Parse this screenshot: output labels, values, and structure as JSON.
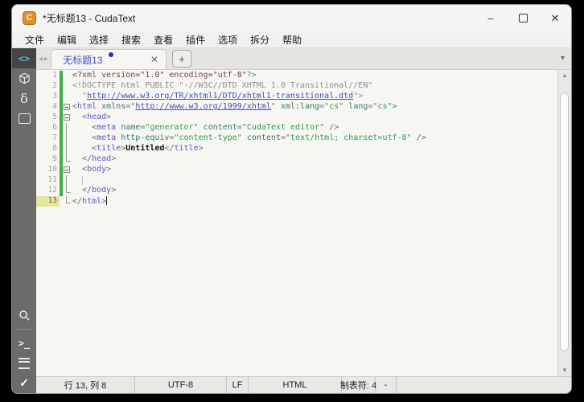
{
  "window": {
    "title": "*无标题13 - CudaText",
    "app_icon_letter": "C",
    "controls": {
      "minimize": "–",
      "close": "✕"
    }
  },
  "menu": {
    "items": [
      "文件",
      "编辑",
      "选择",
      "搜索",
      "查看",
      "插件",
      "选项",
      "拆分",
      "帮助"
    ]
  },
  "tabbar": {
    "nav_left": "◂",
    "nav_right": "▸",
    "tab_label": "无标题13",
    "tab_modified": true,
    "tab_close": "✕",
    "new_tab": "+",
    "chevron": "▾"
  },
  "sidebar": {
    "top_icons": [
      {
        "name": "code-tree-icon",
        "glyph": "code",
        "text": "<>",
        "active": true
      },
      {
        "name": "project-icon",
        "glyph": "cube",
        "text": ""
      },
      {
        "name": "snippets-icon",
        "glyph": "delta",
        "text": "δ"
      },
      {
        "name": "tabs-panel-icon",
        "glyph": "rect",
        "text": ""
      }
    ],
    "bottom_icons": [
      {
        "name": "search-icon",
        "glyph": "search",
        "text": ""
      },
      {
        "name": "divider",
        "glyph": "divider",
        "text": ""
      },
      {
        "name": "console-icon",
        "glyph": "console",
        "text": ">_"
      },
      {
        "name": "output-icon",
        "glyph": "menu",
        "text": ""
      },
      {
        "name": "validate-icon",
        "glyph": "check",
        "text": "✓"
      }
    ]
  },
  "scrollbar": {
    "up": "▲",
    "down": "▼"
  },
  "statusbar": {
    "cells": [
      "行 13, 列 8",
      "UTF-8",
      "LF",
      "HTML",
      "制表符: 4",
      "-"
    ]
  },
  "editor": {
    "lines": [
      {
        "num": 1,
        "fold": "none",
        "changed": true,
        "tokens": [
          {
            "c": "pi",
            "t": "<?xml version=\"1.0\" encoding=\"utf-8\""
          },
          {
            "c": "pig",
            "t": "?>"
          }
        ]
      },
      {
        "num": 2,
        "fold": "none",
        "changed": true,
        "tokens": [
          {
            "c": "cm",
            "t": "<!DOCTYPE html PUBLIC \"-//W3C//DTD XHTML 1.0 Transitional//EN\""
          }
        ]
      },
      {
        "num": 3,
        "fold": "none",
        "changed": true,
        "tokens": [
          {
            "c": "cm",
            "t": "  \""
          },
          {
            "c": "url",
            "t": "http://www.w3.org/TR/xhtml1/DTD/xhtml1-transitional.dtd"
          },
          {
            "c": "cm",
            "t": "\">"
          }
        ]
      },
      {
        "num": 4,
        "fold": "box",
        "changed": true,
        "tokens": [
          {
            "c": "br",
            "t": "<"
          },
          {
            "c": "tag",
            "t": "html"
          },
          {
            "c": "pl",
            "t": " "
          },
          {
            "c": "attr",
            "t": "xmlns"
          },
          {
            "c": "br",
            "t": "="
          },
          {
            "c": "str",
            "t": "\""
          },
          {
            "c": "url",
            "t": "http://www.w3.org/1999/xhtml"
          },
          {
            "c": "str",
            "t": "\""
          },
          {
            "c": "pl",
            "t": " "
          },
          {
            "c": "attr",
            "t": "xml:lang"
          },
          {
            "c": "br",
            "t": "="
          },
          {
            "c": "str",
            "t": "\"cs\""
          },
          {
            "c": "pl",
            "t": " "
          },
          {
            "c": "attr",
            "t": "lang"
          },
          {
            "c": "br",
            "t": "="
          },
          {
            "c": "str",
            "t": "\"cs\""
          },
          {
            "c": "br",
            "t": ">"
          }
        ]
      },
      {
        "num": 5,
        "fold": "box",
        "changed": true,
        "tokens": [
          {
            "c": "pl",
            "t": "  "
          },
          {
            "c": "br",
            "t": "<"
          },
          {
            "c": "tag",
            "t": "head"
          },
          {
            "c": "br",
            "t": ">"
          }
        ]
      },
      {
        "num": 6,
        "fold": "line",
        "changed": true,
        "tokens": [
          {
            "c": "pl",
            "t": "    "
          },
          {
            "c": "br",
            "t": "<"
          },
          {
            "c": "tag",
            "t": "meta"
          },
          {
            "c": "pl",
            "t": " "
          },
          {
            "c": "attr",
            "t": "name"
          },
          {
            "c": "br",
            "t": "="
          },
          {
            "c": "str",
            "t": "\"generator\""
          },
          {
            "c": "pl",
            "t": " "
          },
          {
            "c": "attr",
            "t": "content"
          },
          {
            "c": "br",
            "t": "="
          },
          {
            "c": "str",
            "t": "\"CudaText editor\""
          },
          {
            "c": "pl",
            "t": " "
          },
          {
            "c": "br",
            "t": "/>"
          }
        ]
      },
      {
        "num": 7,
        "fold": "line",
        "changed": true,
        "tokens": [
          {
            "c": "pl",
            "t": "    "
          },
          {
            "c": "br",
            "t": "<"
          },
          {
            "c": "tag",
            "t": "meta"
          },
          {
            "c": "pl",
            "t": " "
          },
          {
            "c": "attr",
            "t": "http-equiv"
          },
          {
            "c": "br",
            "t": "="
          },
          {
            "c": "str",
            "t": "\"content-type\""
          },
          {
            "c": "pl",
            "t": " "
          },
          {
            "c": "attr",
            "t": "content"
          },
          {
            "c": "br",
            "t": "="
          },
          {
            "c": "str",
            "t": "\"text/html; charset=utf-8\""
          },
          {
            "c": "pl",
            "t": " "
          },
          {
            "c": "br",
            "t": "/>"
          }
        ]
      },
      {
        "num": 8,
        "fold": "line",
        "changed": true,
        "tokens": [
          {
            "c": "pl",
            "t": "    "
          },
          {
            "c": "br",
            "t": "<"
          },
          {
            "c": "tag",
            "t": "title"
          },
          {
            "c": "br",
            "t": ">"
          },
          {
            "c": "txt",
            "t": "Untitled"
          },
          {
            "c": "br",
            "t": "</"
          },
          {
            "c": "tag",
            "t": "title"
          },
          {
            "c": "br",
            "t": ">"
          }
        ]
      },
      {
        "num": 9,
        "fold": "end",
        "changed": true,
        "tokens": [
          {
            "c": "pl",
            "t": "  "
          },
          {
            "c": "br",
            "t": "</"
          },
          {
            "c": "tag",
            "t": "head"
          },
          {
            "c": "br",
            "t": ">"
          }
        ]
      },
      {
        "num": 10,
        "fold": "box",
        "changed": true,
        "tokens": [
          {
            "c": "pl",
            "t": "  "
          },
          {
            "c": "br",
            "t": "<"
          },
          {
            "c": "tag",
            "t": "body"
          },
          {
            "c": "br",
            "t": ">"
          }
        ]
      },
      {
        "num": 11,
        "fold": "line",
        "changed": true,
        "guide": true,
        "tokens": []
      },
      {
        "num": 12,
        "fold": "end",
        "changed": true,
        "tokens": [
          {
            "c": "pl",
            "t": "  "
          },
          {
            "c": "br",
            "t": "</"
          },
          {
            "c": "tag",
            "t": "body"
          },
          {
            "c": "br",
            "t": ">"
          }
        ]
      },
      {
        "num": 13,
        "fold": "end",
        "changed": false,
        "current": true,
        "caret": true,
        "tokens": [
          {
            "c": "br",
            "t": "</"
          },
          {
            "c": "tag",
            "t": "html"
          },
          {
            "c": "br",
            "t": ">"
          }
        ]
      }
    ]
  }
}
